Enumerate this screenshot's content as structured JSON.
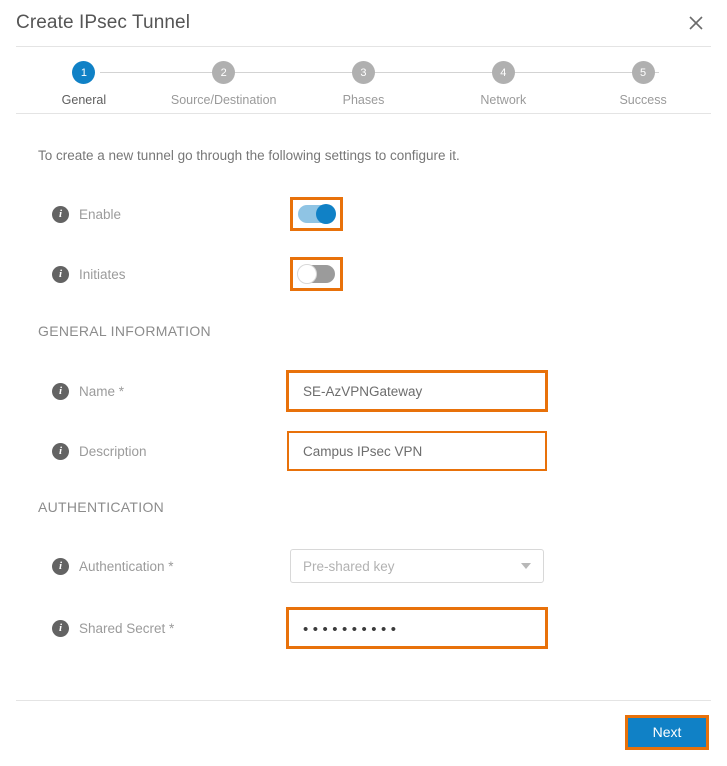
{
  "dialog": {
    "title": "Create IPsec Tunnel",
    "close_icon": "close-icon"
  },
  "stepper": {
    "steps": [
      {
        "number": "1",
        "label": "General",
        "state": "active"
      },
      {
        "number": "2",
        "label": "Source/Destination",
        "state": "inactive"
      },
      {
        "number": "3",
        "label": "Phases",
        "state": "inactive"
      },
      {
        "number": "4",
        "label": "Network",
        "state": "inactive"
      },
      {
        "number": "5",
        "label": "Success",
        "state": "inactive"
      }
    ]
  },
  "body": {
    "intro": "To create a new tunnel go through the following settings to configure it.",
    "toggles": [
      {
        "label": "Enable",
        "state": "on"
      },
      {
        "label": "Initiates",
        "state": "off"
      }
    ],
    "general_information": {
      "heading": "GENERAL INFORMATION",
      "name": {
        "label": "Name *",
        "value": "SE-AzVPNGateway"
      },
      "description": {
        "label": "Description",
        "value": "Campus IPsec VPN"
      }
    },
    "authentication": {
      "heading": "AUTHENTICATION",
      "method": {
        "label": "Authentication *",
        "value": "Pre-shared key"
      },
      "shared_secret": {
        "label": "Shared Secret *",
        "value": "••••••••••"
      }
    }
  },
  "footer": {
    "next_label": "Next"
  },
  "colors": {
    "accent_blue": "#1081c6",
    "highlight_orange": "#e8710a",
    "text_gray": "#9b9b9b"
  }
}
